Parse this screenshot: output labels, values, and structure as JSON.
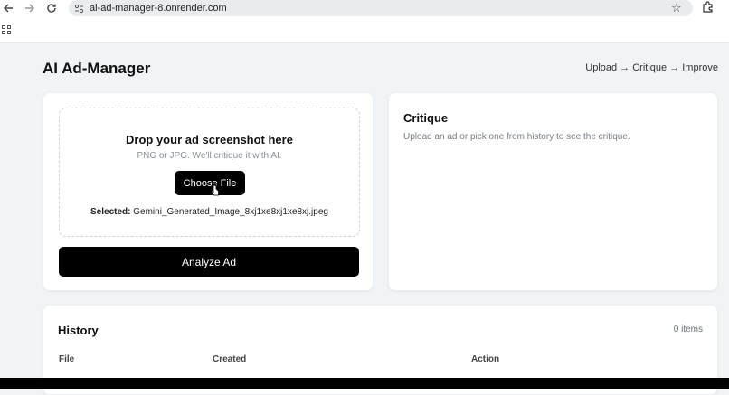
{
  "browser": {
    "url": "ai-ad-manager-8.onrender.com",
    "back_icon": "back-arrow-icon",
    "forward_icon": "forward-arrow-icon",
    "reload_icon": "reload-icon"
  },
  "header": {
    "title": "AI Ad-Manager",
    "steps": "Upload → Critique → Improve"
  },
  "upload": {
    "drop_title": "Drop your ad screenshot here",
    "drop_subtitle": "PNG or JPG. We'll critique it with AI.",
    "choose_label": "Choose File",
    "selected_label": "Selected:",
    "selected_file": "Gemini_Generated_Image_8xj1xe8xj1xe8xj.jpeg",
    "analyze_label": "Analyze Ad"
  },
  "critique": {
    "title": "Critique",
    "empty_text": "Upload an ad or pick one from history to see the critique."
  },
  "history": {
    "title": "History",
    "count": "0 items",
    "columns": [
      "File",
      "Created",
      "Action"
    ]
  },
  "colors": {
    "page_bg": "#f1f4f6",
    "button_bg": "#000000",
    "card_bg": "#ffffff"
  }
}
